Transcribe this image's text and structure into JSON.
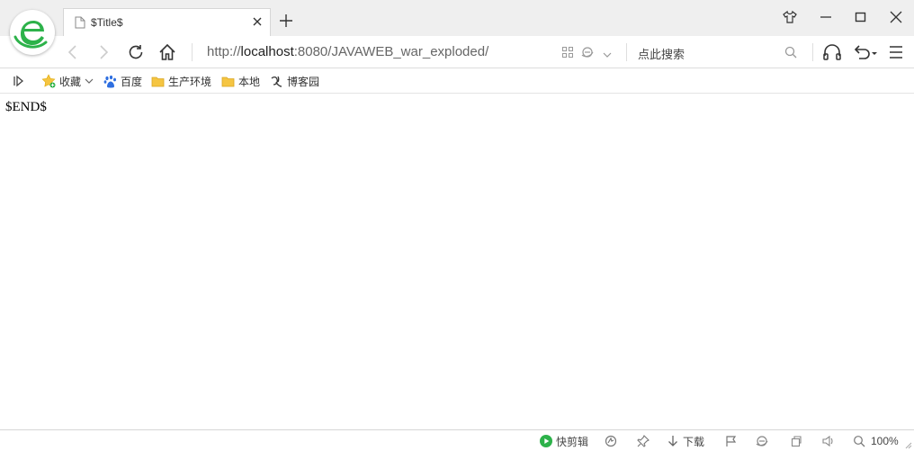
{
  "tab": {
    "title": "$Title$"
  },
  "address": {
    "prefix": "http://",
    "host": "localhost",
    "rest": ":8080/JAVAWEB_war_exploded/"
  },
  "search": {
    "placeholder": "点此搜索"
  },
  "bookmarks": [
    {
      "label": "收藏",
      "icon": "star-icon"
    },
    {
      "label": "百度",
      "icon": "baidu-paw-icon"
    },
    {
      "label": "生产环境",
      "icon": "folder-icon"
    },
    {
      "label": "本地",
      "icon": "folder-icon"
    },
    {
      "label": "博客园",
      "icon": "cnblogs-icon"
    }
  ],
  "content": {
    "text": "$END$"
  },
  "statusbar": {
    "clip_label": "快剪辑",
    "download_label": "下载",
    "zoom": "100%"
  },
  "colors": {
    "accent_green": "#2db24a",
    "folder_yellow": "#f5c542",
    "baidu_blue": "#2f6fe0"
  }
}
